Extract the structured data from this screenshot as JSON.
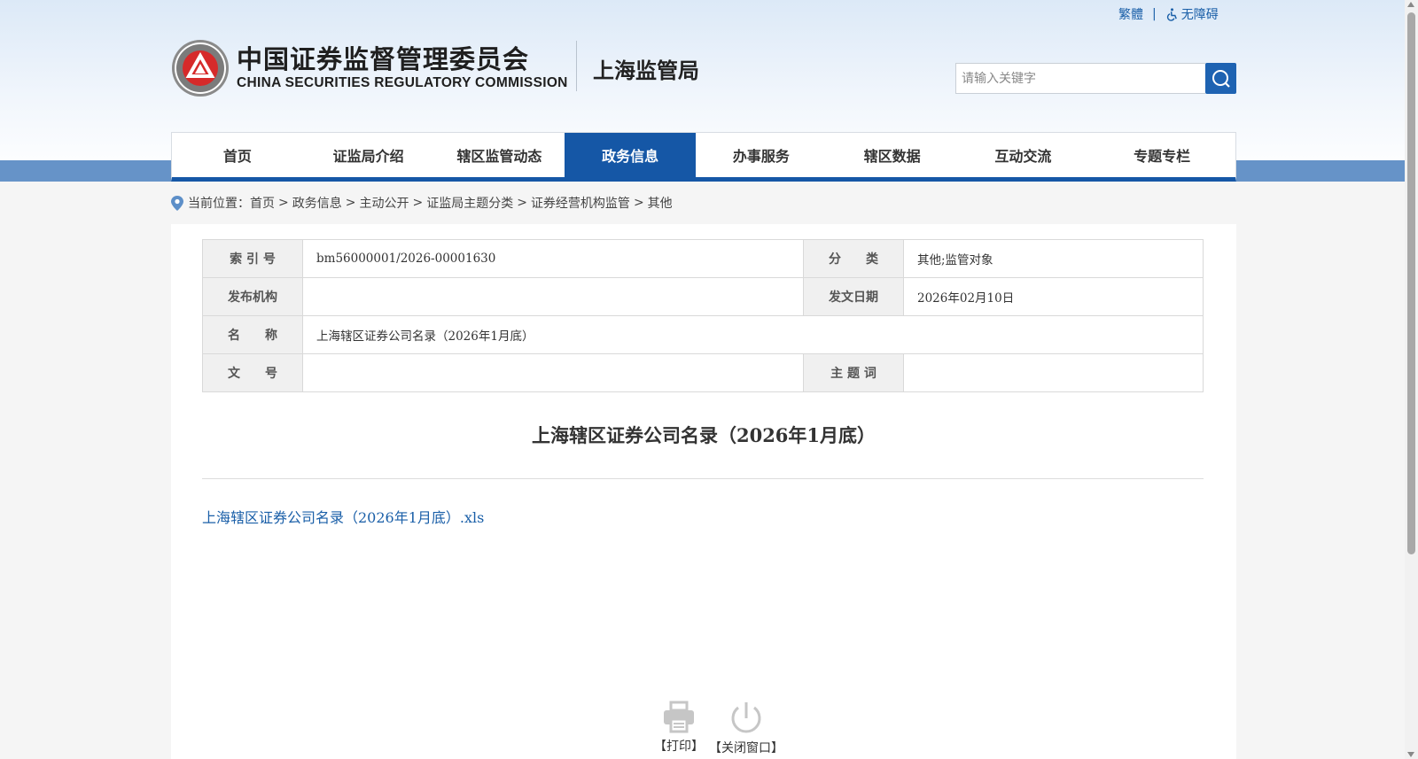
{
  "top_links": {
    "traditional": "繁體",
    "separator": "|",
    "accessibility": "无障碍"
  },
  "header": {
    "logo_cn": "中国证券监督管理委员会",
    "logo_en": "CHINA SECURITIES REGULATORY COMMISSION",
    "bureau": "上海监管局",
    "search_placeholder": "请输入关键字"
  },
  "nav": {
    "items": [
      {
        "label": "首页",
        "active": false
      },
      {
        "label": "证监局介绍",
        "active": false
      },
      {
        "label": "辖区监管动态",
        "active": false
      },
      {
        "label": "政务信息",
        "active": true
      },
      {
        "label": "办事服务",
        "active": false
      },
      {
        "label": "辖区数据",
        "active": false
      },
      {
        "label": "互动交流",
        "active": false
      },
      {
        "label": "专题专栏",
        "active": false
      }
    ]
  },
  "breadcrumb": {
    "prefix": "当前位置：",
    "items": [
      "首页",
      "政务信息",
      "主动公开",
      "证监局主题分类",
      "证券经营机构监管",
      "其他"
    ],
    "separator": ">"
  },
  "meta": {
    "index_label": "索 引 号",
    "index_value": "bm56000001/2026-00001630",
    "category_label": "分　　类",
    "category_value": "其他;监管对象",
    "publisher_label": "发布机构",
    "publisher_value": "",
    "date_label": "发文日期",
    "date_value": "2026年02月10日",
    "name_label": "名　　称",
    "name_value": "上海辖区证券公司名录（2026年1月底）",
    "docno_label": "文　　号",
    "docno_value": "",
    "subject_label": "主 题 词",
    "subject_value": ""
  },
  "document": {
    "title": "上海辖区证券公司名录（2026年1月底）",
    "attachment": "上海辖区证券公司名录（2026年1月底）.xls"
  },
  "actions": {
    "print": "【打印】",
    "close": "【关闭窗口】"
  },
  "colors": {
    "brand_blue": "#1557a6",
    "link_blue": "#1a5fa8",
    "band_blue": "#6693c8",
    "emblem_red": "#d62a2a"
  }
}
